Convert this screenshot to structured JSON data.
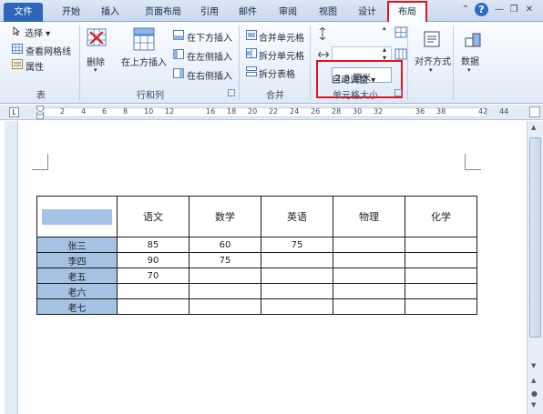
{
  "tabs": [
    "文件",
    "开始",
    "插入",
    "页面布局",
    "引用",
    "邮件",
    "审阅",
    "视图",
    "设计",
    "布局"
  ],
  "ribbon": {
    "table_group": {
      "label": "表",
      "select": "选择",
      "view_gridlines": "查看网格线",
      "properties": "属性"
    },
    "rows_cols_group": {
      "label": "行和列",
      "delete": "删除",
      "insert_above": "在上方插入",
      "insert_below": "在下方插入",
      "insert_left": "在左侧插入",
      "insert_right": "在右侧插入"
    },
    "merge_group": {
      "label": "合并",
      "merge_cells": "合并单元格",
      "split_cells": "拆分单元格",
      "split_table": "拆分表格"
    },
    "cell_size_group": {
      "label": "单元格大小",
      "width_value": "2.8 厘米",
      "autofit": "自动调整"
    },
    "alignment": "对齐方式",
    "data": "数据"
  },
  "ruler_labels": [
    "2",
    "4",
    "6",
    "8",
    "10",
    "12",
    "16",
    "18",
    "20",
    "22",
    "24",
    "26",
    "28",
    "30",
    "32",
    "36",
    "38",
    "42",
    "44"
  ],
  "table": {
    "headers": [
      "",
      "语文",
      "数学",
      "英语",
      "物理",
      "化学"
    ],
    "rows": [
      [
        "张三",
        "85",
        "60",
        "75",
        "",
        ""
      ],
      [
        "李四",
        "90",
        "75",
        "",
        "",
        ""
      ],
      [
        "老五",
        "70",
        "",
        "",
        "",
        ""
      ],
      [
        "老六",
        "",
        "",
        "",
        "",
        ""
      ],
      [
        "老七",
        "",
        "",
        "",
        "",
        ""
      ]
    ]
  },
  "colors": {
    "accent_red": "#e3141b",
    "file_tab": "#2c66b8",
    "selection": "#a6c3e6"
  }
}
